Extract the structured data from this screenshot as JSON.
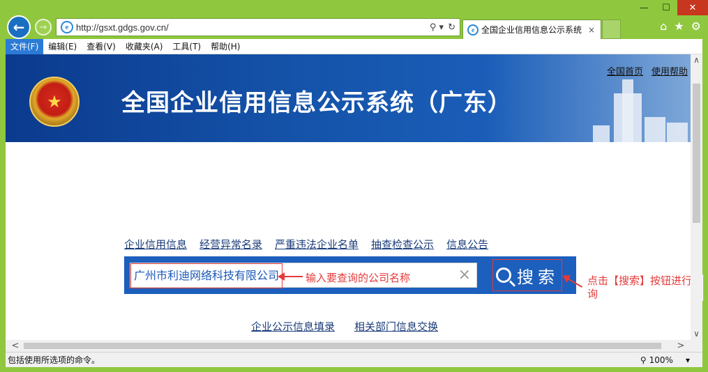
{
  "browser": {
    "url": "http://gsxt.gdgs.gov.cn/",
    "tab_title": "全国企业信用信息公示系统",
    "tab_close": "×",
    "back": "←",
    "forward": "→",
    "addr_search": "⚲ ▾",
    "addr_refresh": "↻",
    "home": "⌂",
    "favorites": "★",
    "tools": "⚙",
    "min": "—",
    "max": "☐",
    "close": "✕",
    "menu": [
      "文件(F)",
      "编辑(E)",
      "查看(V)",
      "收藏夹(A)",
      "工具(T)",
      "帮助(H)"
    ]
  },
  "page": {
    "title": "全国企业信用信息公示系统（广东）",
    "top_links": [
      "全国首页",
      "使用帮助"
    ],
    "nav_links": [
      "企业信用信息",
      "经营异常名录",
      "严重违法企业名单",
      "抽查检查公示",
      "信息公告"
    ],
    "search": {
      "value": "广州市利迪网络科技有限公司",
      "clear": "×",
      "button": "搜索"
    },
    "annotations": {
      "input_hint": "输入要查询的公司名称",
      "button_hint": "点击【搜索】按钮进行查询"
    },
    "bottom_links": [
      "企业公示信息填录",
      "相关部门信息交换"
    ]
  },
  "status": {
    "text": "包括使用所选项的命令。",
    "zoom": "100%",
    "zoom_arrow": "▾"
  },
  "scroll": {
    "up": "∧",
    "down": "∨",
    "left": "<",
    "right": ">"
  }
}
